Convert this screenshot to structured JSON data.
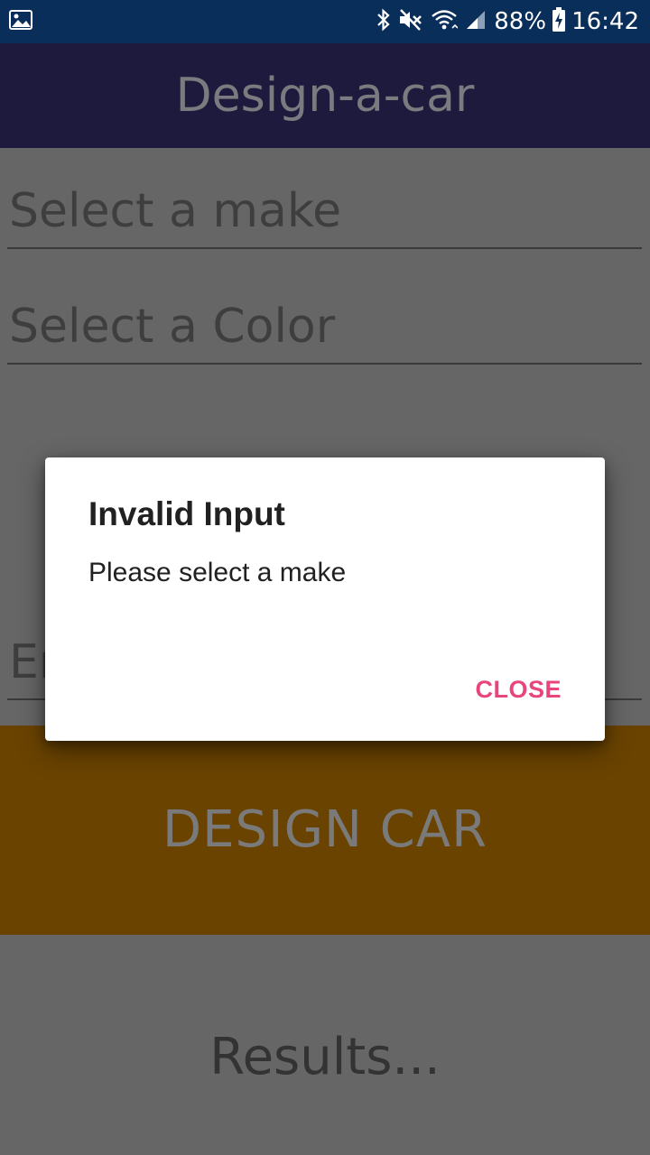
{
  "status_bar": {
    "battery_percent": "88%",
    "time": "16:42",
    "icons": [
      "image-icon",
      "bluetooth-icon",
      "mute-icon",
      "wifi-icon",
      "signal-icon",
      "battery-charging-icon"
    ]
  },
  "app_bar": {
    "title": "Design-a-car"
  },
  "form": {
    "make_placeholder": "Select a make",
    "color_placeholder": "Select a Color",
    "third_field_partial": "En",
    "design_button_label": "DESIGN CAR",
    "results_text": "Results..."
  },
  "dialog": {
    "title": "Invalid Input",
    "message": "Please select a make",
    "close_label": "CLOSE"
  },
  "colors": {
    "status_bar": "#0a2e5a",
    "app_bar": "#1e1a3e",
    "button": "#6a4300",
    "accent": "#e8457e"
  }
}
